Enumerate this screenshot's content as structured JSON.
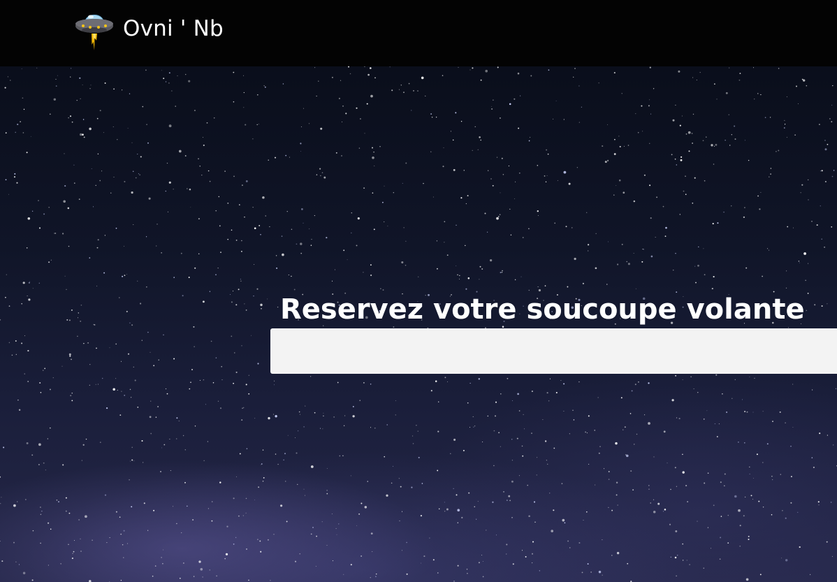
{
  "header": {
    "brand_name": "Ovni ' Nb",
    "logo_icon": "ufo-icon"
  },
  "hero": {
    "title": "Reservez votre soucoupe volante",
    "input": {
      "value": "",
      "placeholder": ""
    }
  },
  "colors": {
    "navbar_bg": "#030303",
    "text": "#ffffff",
    "input_bg": "#f3f3f3",
    "sky_top": "#0a0e1b",
    "sky_bottom": "#26284a"
  }
}
